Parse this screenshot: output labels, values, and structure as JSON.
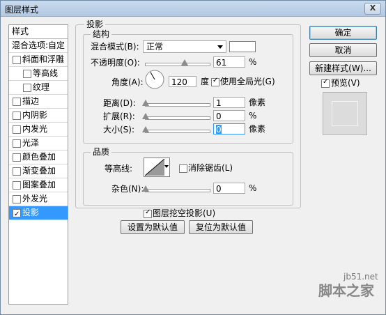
{
  "window": {
    "title": "图层样式",
    "close": "X"
  },
  "sidebar": {
    "header": "样式",
    "items": [
      {
        "label": "混合选项:自定",
        "checkbox": false,
        "checked": false,
        "indent": false,
        "selected": false
      },
      {
        "label": "斜面和浮雕",
        "checkbox": true,
        "checked": false,
        "indent": false,
        "selected": false
      },
      {
        "label": "等高线",
        "checkbox": true,
        "checked": false,
        "indent": true,
        "selected": false
      },
      {
        "label": "纹理",
        "checkbox": true,
        "checked": false,
        "indent": true,
        "selected": false
      },
      {
        "label": "描边",
        "checkbox": true,
        "checked": false,
        "indent": false,
        "selected": false
      },
      {
        "label": "内阴影",
        "checkbox": true,
        "checked": false,
        "indent": false,
        "selected": false
      },
      {
        "label": "内发光",
        "checkbox": true,
        "checked": false,
        "indent": false,
        "selected": false
      },
      {
        "label": "光泽",
        "checkbox": true,
        "checked": false,
        "indent": false,
        "selected": false
      },
      {
        "label": "颜色叠加",
        "checkbox": true,
        "checked": false,
        "indent": false,
        "selected": false
      },
      {
        "label": "渐变叠加",
        "checkbox": true,
        "checked": false,
        "indent": false,
        "selected": false
      },
      {
        "label": "图案叠加",
        "checkbox": true,
        "checked": false,
        "indent": false,
        "selected": false
      },
      {
        "label": "外发光",
        "checkbox": true,
        "checked": false,
        "indent": false,
        "selected": false
      },
      {
        "label": "投影",
        "checkbox": true,
        "checked": true,
        "indent": false,
        "selected": true
      }
    ]
  },
  "shadow": {
    "group_title": "投影",
    "structure": {
      "title": "结构",
      "blend_mode_label": "混合模式(B):",
      "blend_mode_value": "正常",
      "opacity_label": "不透明度(O):",
      "opacity_value": "61",
      "opacity_unit": "%",
      "opacity_level": 0.61,
      "angle_label": "角度(A):",
      "angle_value": "120",
      "angle_unit": "度",
      "angle_degrees": 120,
      "global_light_label": "使用全局光(G)",
      "global_light_checked": true,
      "distance_label": "距离(D):",
      "distance_value": "1",
      "distance_unit": "像素",
      "spread_label": "扩展(R):",
      "spread_value": "0",
      "spread_unit": "%",
      "size_label": "大小(S):",
      "size_value": "0",
      "size_unit": "像素"
    },
    "quality": {
      "title": "品质",
      "contour_label": "等高线:",
      "antialias_label": "消除锯齿(L)",
      "antialias_checked": false,
      "noise_label": "杂色(N):",
      "noise_value": "0",
      "noise_unit": "%"
    },
    "knockout_label": "图层挖空投影(U)",
    "knockout_checked": true,
    "set_default_label": "设置为默认值",
    "reset_default_label": "复位为默认值"
  },
  "buttons": {
    "ok": "确定",
    "cancel": "取消",
    "new_style": "新建样式(W)...",
    "preview_label": "预览(V)",
    "preview_checked": true
  },
  "watermark": {
    "site": "jb51.net",
    "brand": "脚本之家"
  },
  "colors": {
    "selection": "#3399ff",
    "title_bar": "#b3c8e2"
  }
}
